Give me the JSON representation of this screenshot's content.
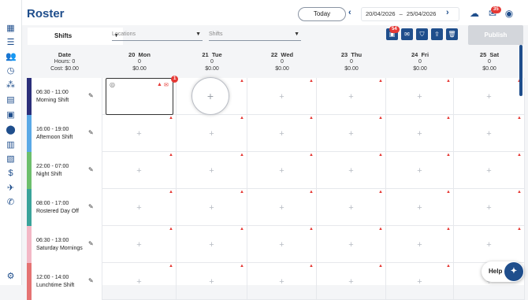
{
  "app": {
    "title": "Roster"
  },
  "sidebar": {
    "icons": [
      "dashboard-icon",
      "list-icon",
      "group-icon",
      "clock-icon",
      "org-icon",
      "clipboard-icon",
      "calendar-icon",
      "location-icon",
      "building-icon",
      "document-icon",
      "dollar-icon",
      "plane-icon",
      "phone-icon",
      "settings-icon"
    ]
  },
  "header": {
    "today_label": "Today",
    "date_from": "20/04/2026",
    "date_sep": "–",
    "date_to": "25/04/2026",
    "notif_count": "35"
  },
  "toolbar": {
    "shift_select": "Shifts",
    "locations_placeholder": "Locations",
    "shifts_placeholder": "Shifts",
    "mail_count": "54",
    "publish_label": "Publish"
  },
  "table": {
    "first_col": {
      "title": "Date",
      "hours": "Hours: 0",
      "cost": "Cost: $0.00"
    },
    "days": [
      {
        "day": "20",
        "name": "Mon",
        "hours": "0",
        "cost": "$0.00"
      },
      {
        "day": "21",
        "name": "Tue",
        "hours": "0",
        "cost": "$0.00"
      },
      {
        "day": "22",
        "name": "Wed",
        "hours": "0",
        "cost": "$0.00"
      },
      {
        "day": "23",
        "name": "Thu",
        "hours": "0",
        "cost": "$0.00"
      },
      {
        "day": "24",
        "name": "Fri",
        "hours": "0",
        "cost": "$0.00"
      },
      {
        "day": "25",
        "name": "Sat",
        "hours": "0",
        "cost": "$0.00"
      }
    ],
    "shifts": [
      {
        "time": "06:30 - 11:00",
        "name": "Morning Shift",
        "color": "#2b2f7a"
      },
      {
        "time": "16:00 - 19:00",
        "name": "Afternoon Shift",
        "color": "#5aa9e6"
      },
      {
        "time": "22:00 - 07:00",
        "name": "Night Shift",
        "color": "#6cbf6c"
      },
      {
        "time": "08:00 - 17:00",
        "name": "Rostered Day Off",
        "color": "#3aa39a"
      },
      {
        "time": "06:30 - 13:00",
        "name": "Saturday Mornings",
        "color": "#f3b8c6"
      },
      {
        "time": "12:00 - 14:00",
        "name": "Lunchtime Shift",
        "color": "#e57373"
      }
    ],
    "selected_badge": "1"
  },
  "help": {
    "label": "Help"
  }
}
